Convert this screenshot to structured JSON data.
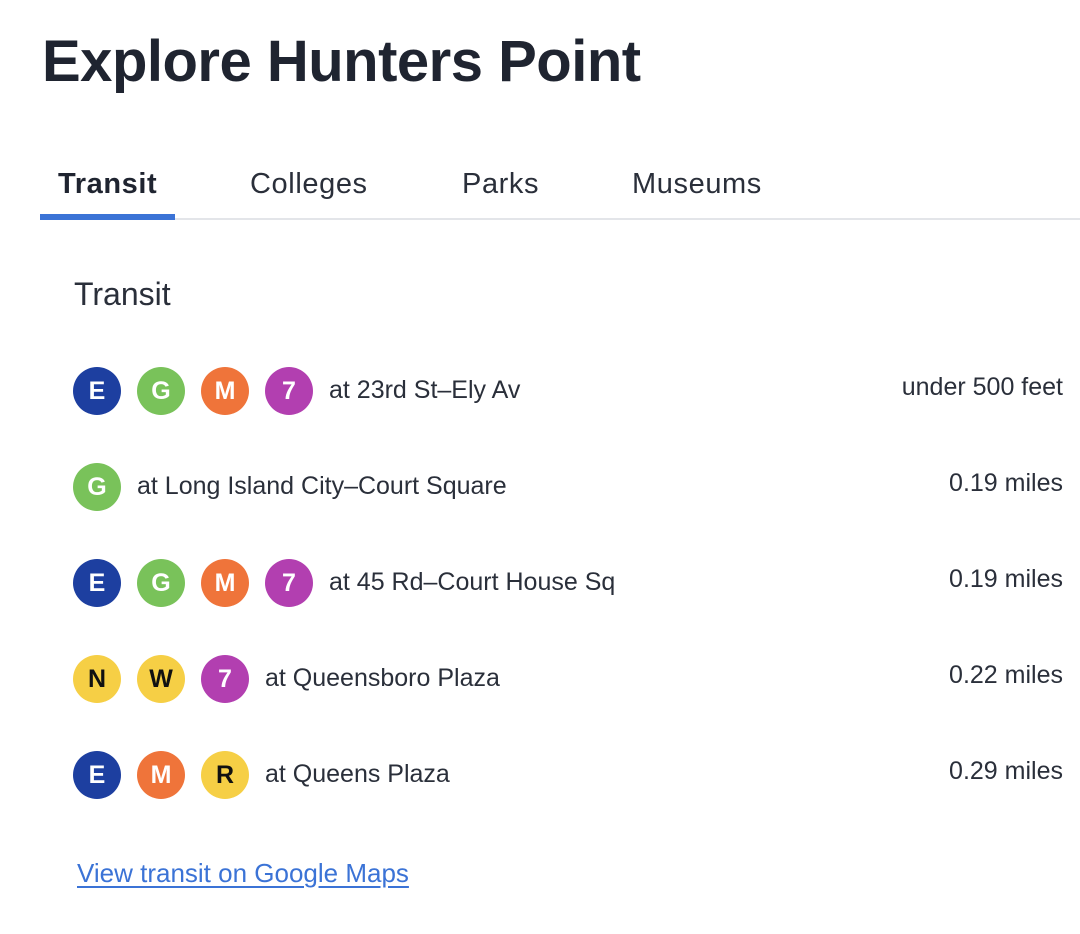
{
  "page": {
    "title": "Explore Hunters Point"
  },
  "tabs": [
    {
      "label": "Transit",
      "active": true
    },
    {
      "label": "Colleges",
      "active": false
    },
    {
      "label": "Parks",
      "active": false
    },
    {
      "label": "Museums",
      "active": false
    }
  ],
  "section": {
    "heading": "Transit"
  },
  "line_colors": {
    "E": "#1d3fa0",
    "G": "#79c25a",
    "M": "#ef743a",
    "7": "#b23fb0",
    "N": "#f6cf45",
    "W": "#f6cf45",
    "R": "#f6cf45"
  },
  "dark_text_lines": [
    "N",
    "W",
    "R"
  ],
  "stations": [
    {
      "lines": [
        "E",
        "G",
        "M",
        "7"
      ],
      "name": "at 23rd St–Ely Av",
      "distance": "under 500 feet"
    },
    {
      "lines": [
        "G"
      ],
      "name": "at Long Island City–Court Square",
      "distance": "0.19 miles"
    },
    {
      "lines": [
        "E",
        "G",
        "M",
        "7"
      ],
      "name": "at 45 Rd–Court House Sq",
      "distance": "0.19 miles"
    },
    {
      "lines": [
        "N",
        "W",
        "7"
      ],
      "name": "at Queensboro Plaza",
      "distance": "0.22 miles"
    },
    {
      "lines": [
        "E",
        "M",
        "R"
      ],
      "name": "at Queens Plaza",
      "distance": "0.29 miles"
    }
  ],
  "link": {
    "label": "View transit on Google Maps"
  }
}
